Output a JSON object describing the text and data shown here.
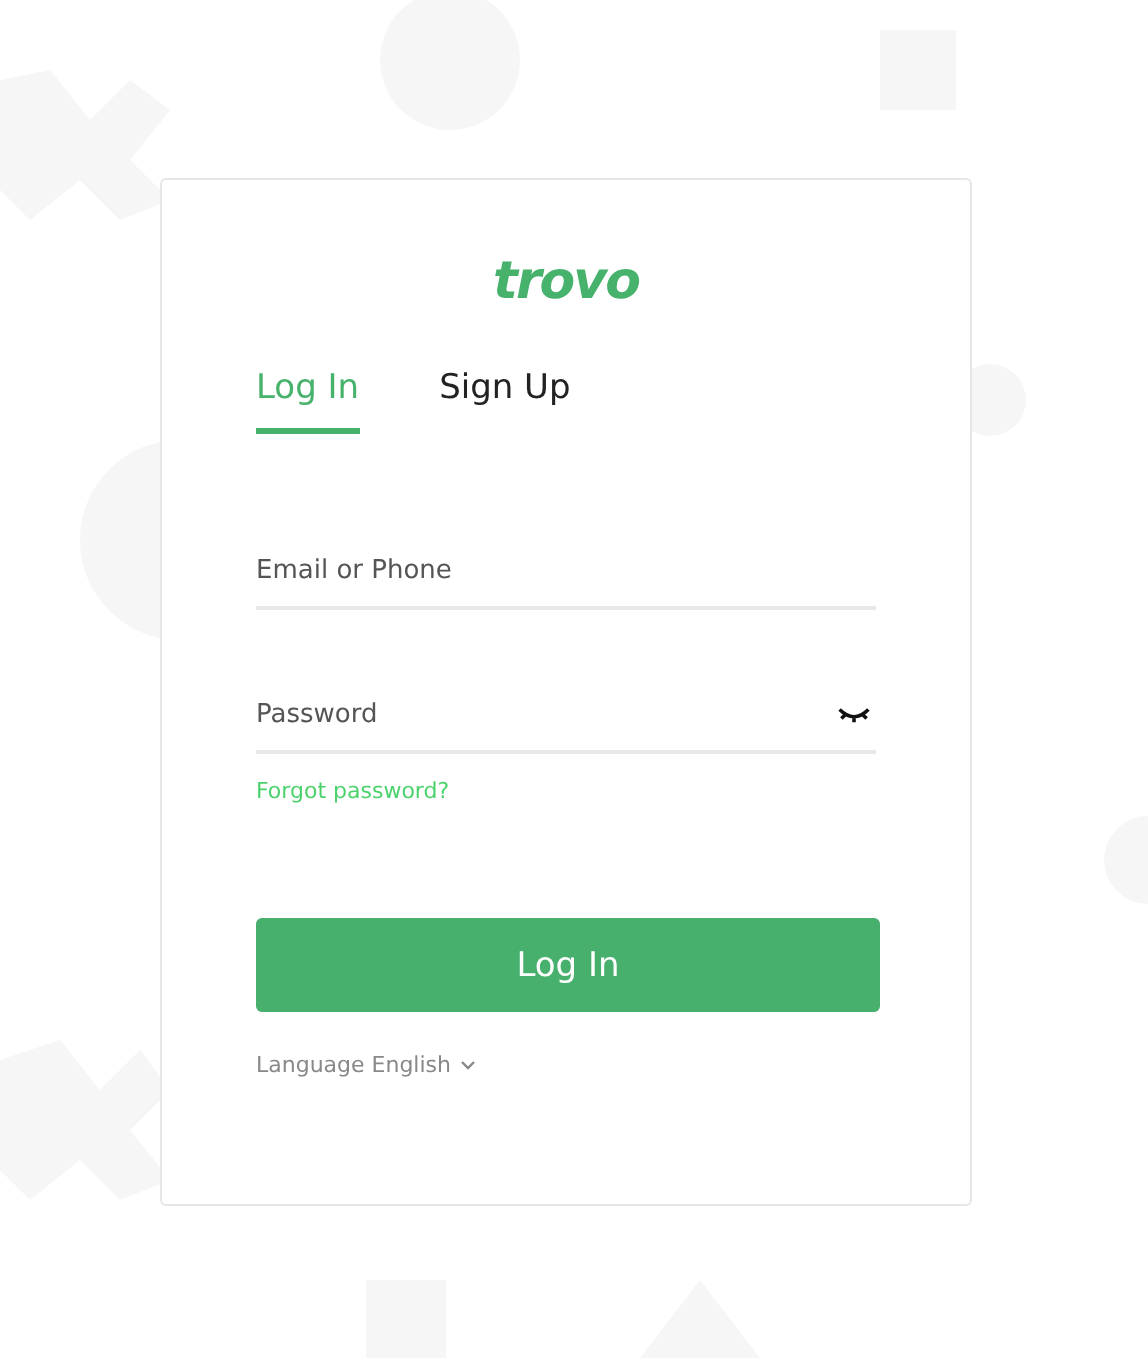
{
  "logo": "trovo",
  "tabs": [
    {
      "label": "Log In",
      "selected": true
    },
    {
      "label": "Sign Up",
      "selected": false
    }
  ],
  "email": {
    "placeholder": "Email or Phone"
  },
  "password": {
    "placeholder": "Password",
    "visible": false
  },
  "forgot_link": "Forgot password?",
  "submit": "Log In",
  "language": {
    "label": "Language",
    "value": "English"
  }
}
